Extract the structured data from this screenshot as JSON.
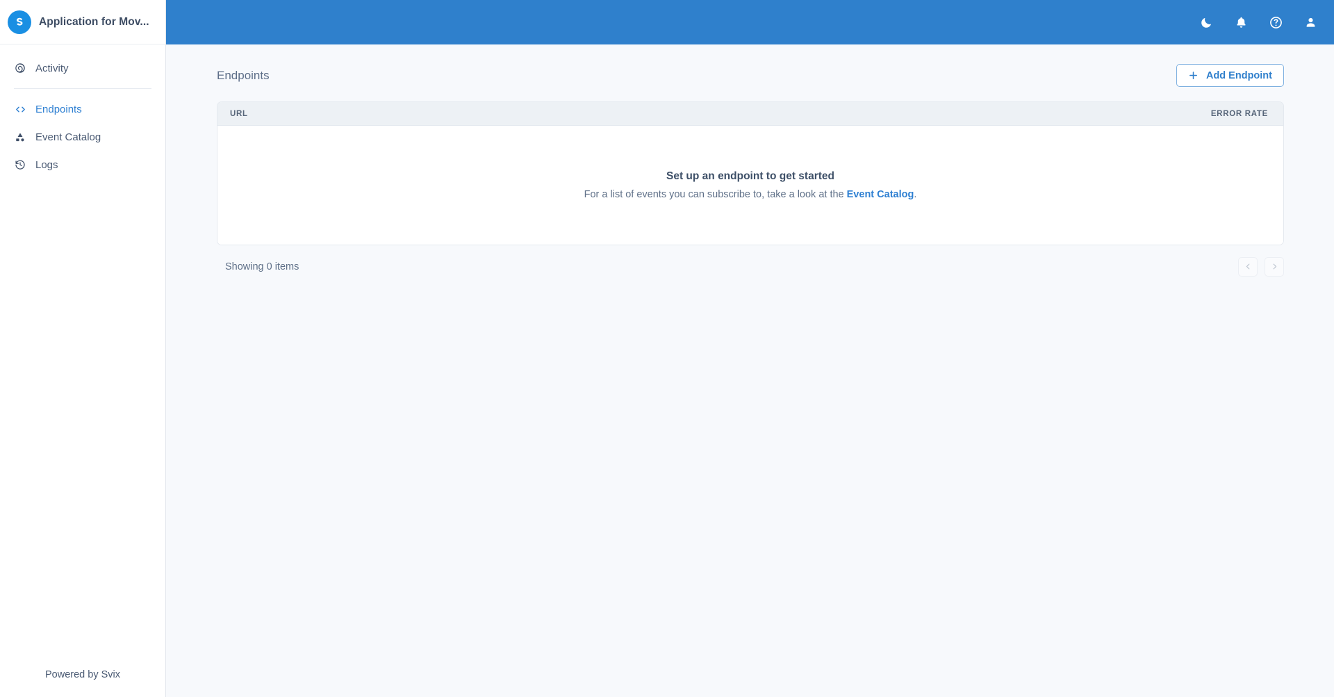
{
  "sidebar": {
    "brand": {
      "title": "Application for Mov...",
      "logo_icon": "svix-logo-icon"
    },
    "items": [
      {
        "label": "Activity",
        "icon": "activity-spiral-icon",
        "active": false
      },
      {
        "label": "Endpoints",
        "icon": "code-brackets-icon",
        "active": true
      },
      {
        "label": "Event Catalog",
        "icon": "shapes-icon",
        "active": false
      },
      {
        "label": "Logs",
        "icon": "history-clock-icon",
        "active": false
      }
    ],
    "footer": "Powered by Svix"
  },
  "topbar": {
    "background_color": "#2f80cc",
    "icons": [
      {
        "name": "dark-mode-moon-icon",
        "label": "Dark mode"
      },
      {
        "name": "notifications-bell-icon",
        "label": "Notifications"
      },
      {
        "name": "help-question-icon",
        "label": "Help"
      },
      {
        "name": "user-account-icon",
        "label": "Account"
      }
    ]
  },
  "page": {
    "title": "Endpoints",
    "add_button": {
      "label": "Add Endpoint",
      "icon": "plus-icon"
    }
  },
  "table": {
    "columns": [
      {
        "key": "url",
        "label": "URL"
      },
      {
        "key": "error_rate",
        "label": "ERROR RATE"
      }
    ],
    "rows": [],
    "empty_state": {
      "title": "Set up an endpoint to get started",
      "description_prefix": "For a list of events you can subscribe to, take a look at the ",
      "link_label": "Event Catalog",
      "description_suffix": "."
    }
  },
  "pagination": {
    "showing_text": "Showing 0 items",
    "prev_label": "‹",
    "next_label": "›"
  },
  "colors": {
    "accent": "#2f80d2",
    "header": "#2f80cc",
    "page_background": "#f7f9fc",
    "table_header_background": "#edf1f5"
  }
}
